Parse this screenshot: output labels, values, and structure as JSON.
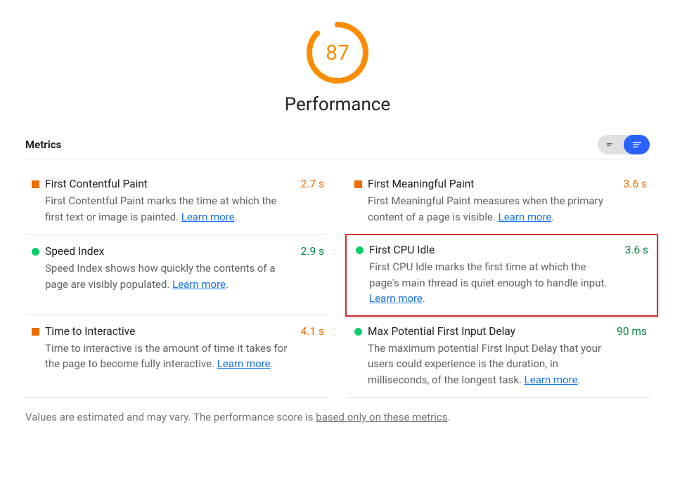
{
  "gauge": {
    "score": "87",
    "label": "Performance",
    "fraction": 0.87,
    "color": "#fb8c00"
  },
  "metrics_heading": "Metrics",
  "metrics": [
    {
      "title": "First Contentful Paint",
      "value": "2.7 s",
      "value_class": "val-orange",
      "marker": "square",
      "desc": "First Contentful Paint marks the time at which the first text or image is painted. ",
      "learn": "Learn more",
      "highlighted": false
    },
    {
      "title": "First Meaningful Paint",
      "value": "3.6 s",
      "value_class": "val-orange",
      "marker": "square",
      "desc": "First Meaningful Paint measures when the primary content of a page is visible. ",
      "learn": "Learn more",
      "highlighted": false
    },
    {
      "title": "Speed Index",
      "value": "2.9 s",
      "value_class": "val-green",
      "marker": "circle",
      "desc": "Speed Index shows how quickly the contents of a page are visibly populated. ",
      "learn": "Learn more",
      "highlighted": false
    },
    {
      "title": "First CPU Idle",
      "value": "3.6 s",
      "value_class": "val-green",
      "marker": "circle",
      "desc": "First CPU Idle marks the first time at which the page's main thread is quiet enough to handle input. ",
      "learn": "Learn more",
      "highlighted": true
    },
    {
      "title": "Time to Interactive",
      "value": "4.1 s",
      "value_class": "val-orange",
      "marker": "square",
      "desc": "Time to interactive is the amount of time it takes for the page to become fully interactive. ",
      "learn": "Learn more",
      "highlighted": false
    },
    {
      "title": "Max Potential First Input Delay",
      "value": "90 ms",
      "value_class": "val-green",
      "marker": "circle",
      "desc": "The maximum potential First Input Delay that your users could experience is the duration, in milliseconds, of the longest task. ",
      "learn": "Learn more",
      "highlighted": false
    }
  ],
  "footnote": {
    "prefix": "Values are estimated and may vary. The performance score is ",
    "link": "based only on these metrics",
    "suffix": "."
  }
}
